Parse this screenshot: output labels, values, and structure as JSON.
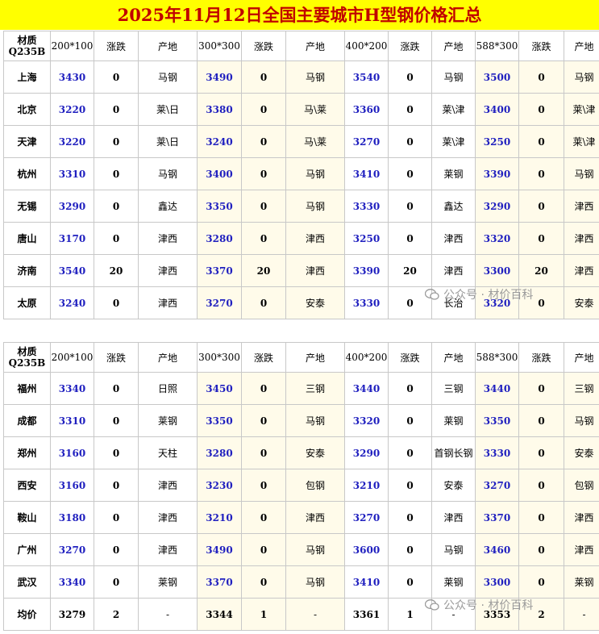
{
  "title": "2025年11月12日全国主要城市H型钢价格汇总",
  "header": {
    "material_line1": "材质",
    "material_line2": "Q235B",
    "specs": [
      "200*100",
      "300*300",
      "400*200",
      "588*300"
    ],
    "change_label": "涨跌",
    "origin_label": "产地"
  },
  "table1": [
    {
      "city": "上海",
      "cells": [
        [
          "3430",
          "0",
          "马钢"
        ],
        [
          "3490",
          "0",
          "马钢"
        ],
        [
          "3540",
          "0",
          "马钢"
        ],
        [
          "3500",
          "0",
          "马钢"
        ]
      ]
    },
    {
      "city": "北京",
      "cells": [
        [
          "3220",
          "0",
          "莱\\日"
        ],
        [
          "3380",
          "0",
          "马\\莱"
        ],
        [
          "3360",
          "0",
          "莱\\津"
        ],
        [
          "3400",
          "0",
          "莱\\津"
        ]
      ]
    },
    {
      "city": "天津",
      "cells": [
        [
          "3220",
          "0",
          "莱\\日"
        ],
        [
          "3240",
          "0",
          "马\\莱"
        ],
        [
          "3270",
          "0",
          "莱\\津"
        ],
        [
          "3250",
          "0",
          "莱\\津"
        ]
      ]
    },
    {
      "city": "杭州",
      "cells": [
        [
          "3310",
          "0",
          "马钢"
        ],
        [
          "3400",
          "0",
          "马钢"
        ],
        [
          "3410",
          "0",
          "莱钢"
        ],
        [
          "3390",
          "0",
          "马钢"
        ]
      ]
    },
    {
      "city": "无锡",
      "cells": [
        [
          "3290",
          "0",
          "鑫达"
        ],
        [
          "3350",
          "0",
          "马钢"
        ],
        [
          "3330",
          "0",
          "鑫达"
        ],
        [
          "3290",
          "0",
          "津西"
        ]
      ]
    },
    {
      "city": "唐山",
      "cells": [
        [
          "3170",
          "0",
          "津西"
        ],
        [
          "3280",
          "0",
          "津西"
        ],
        [
          "3250",
          "0",
          "津西"
        ],
        [
          "3320",
          "0",
          "津西"
        ]
      ]
    },
    {
      "city": "济南",
      "cells": [
        [
          "3540",
          "20",
          "津西"
        ],
        [
          "3370",
          "20",
          "津西"
        ],
        [
          "3390",
          "20",
          "津西"
        ],
        [
          "3300",
          "20",
          "津西"
        ]
      ]
    },
    {
      "city": "太原",
      "cells": [
        [
          "3240",
          "0",
          "津西"
        ],
        [
          "3270",
          "0",
          "安泰"
        ],
        [
          "3330",
          "0",
          "长治"
        ],
        [
          "3320",
          "0",
          "安泰"
        ]
      ]
    }
  ],
  "table2": [
    {
      "city": "福州",
      "cells": [
        [
          "3340",
          "0",
          "日照"
        ],
        [
          "3450",
          "0",
          "三钢"
        ],
        [
          "3440",
          "0",
          "三钢"
        ],
        [
          "3440",
          "0",
          "三钢"
        ]
      ]
    },
    {
      "city": "成都",
      "cells": [
        [
          "3310",
          "0",
          "莱钢"
        ],
        [
          "3350",
          "0",
          "马钢"
        ],
        [
          "3320",
          "0",
          "莱钢"
        ],
        [
          "3350",
          "0",
          "马钢"
        ]
      ]
    },
    {
      "city": "郑州",
      "cells": [
        [
          "3160",
          "0",
          "天柱"
        ],
        [
          "3280",
          "0",
          "安泰"
        ],
        [
          "3290",
          "0",
          "首钢长钢"
        ],
        [
          "3330",
          "0",
          "安泰"
        ]
      ]
    },
    {
      "city": "西安",
      "cells": [
        [
          "3160",
          "0",
          "津西"
        ],
        [
          "3230",
          "0",
          "包钢"
        ],
        [
          "3210",
          "0",
          "安泰"
        ],
        [
          "3270",
          "0",
          "包钢"
        ]
      ]
    },
    {
      "city": "鞍山",
      "cells": [
        [
          "3180",
          "0",
          "津西"
        ],
        [
          "3210",
          "0",
          "津西"
        ],
        [
          "3270",
          "0",
          "津西"
        ],
        [
          "3370",
          "0",
          "津西"
        ]
      ]
    },
    {
      "city": "广州",
      "cells": [
        [
          "3270",
          "0",
          "津西"
        ],
        [
          "3490",
          "0",
          "马钢"
        ],
        [
          "3600",
          "0",
          "马钢"
        ],
        [
          "3460",
          "0",
          "津西"
        ]
      ]
    },
    {
      "city": "武汉",
      "cells": [
        [
          "3340",
          "0",
          "莱钢"
        ],
        [
          "3370",
          "0",
          "马钢"
        ],
        [
          "3410",
          "0",
          "莱钢"
        ],
        [
          "3300",
          "0",
          "莱钢"
        ]
      ]
    }
  ],
  "average": {
    "label": "均价",
    "cells": [
      [
        "3279",
        "2",
        "-"
      ],
      [
        "3344",
        "1",
        "-"
      ],
      [
        "3361",
        "1",
        "-"
      ],
      [
        "3353",
        "2",
        "-"
      ]
    ]
  },
  "watermark": "公众号 · 材价百科",
  "colors": {
    "title_bg": "#ffff00",
    "title_text": "#c00000",
    "price_text": "#1f1fbf",
    "cream_bg": "#fffbea",
    "grid": "#c8c8c8"
  }
}
